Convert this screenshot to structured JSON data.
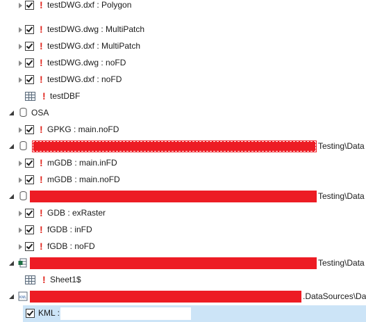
{
  "rows": [
    {
      "label": "testDWG.dxf : Polygon"
    },
    {
      "label": "testDWG.dwg : MultiPatch"
    },
    {
      "label": "testDWG.dxf : MultiPatch"
    },
    {
      "label": "testDWG.dwg : noFD"
    },
    {
      "label": "testDWG.dxf : noFD"
    },
    {
      "label": "testDBF"
    },
    {
      "label": "OSA"
    },
    {
      "label": "GPKG : main.noFD"
    },
    {
      "suffix": "Testing\\Data"
    },
    {
      "label": "mGDB : main.inFD"
    },
    {
      "label": "mGDB : main.noFD"
    },
    {
      "suffix": "Testing\\Data"
    },
    {
      "label": "GDB : exRaster"
    },
    {
      "label": "fGDB : inFD"
    },
    {
      "label": "fGDB : noFD"
    },
    {
      "suffix": "Testing\\Data"
    },
    {
      "label": "Sheet1$"
    },
    {
      "suffix": ".DataSources\\Da"
    },
    {
      "label": "KML :"
    }
  ],
  "warning_glyph": "!",
  "colors": {
    "redaction": "#ed1c24",
    "warning": "#e0241c",
    "selection": "#cce4f7"
  },
  "icons": [
    "expand-arrow-icon",
    "checkbox-icon",
    "warning-icon",
    "table-icon",
    "database-icon",
    "excel-icon",
    "kml-icon"
  ]
}
